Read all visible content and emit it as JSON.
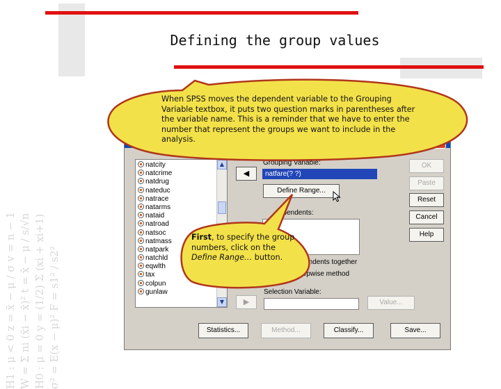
{
  "slide": {
    "title": "Defining the group values",
    "formula_lines": [
      "H1 : μ < 0     z = x̄ − μ / σ     v = n − 1",
      "W = Σ ni (x̄i − x̄)²     t = x̄ − μ / s/√n",
      "H0 : μ = 0     y = (1/2) Σ (xi + xi+1)",
      "σ² = E(x − μ)²     F = s1² / s2²"
    ]
  },
  "callouts": {
    "top": "When SPSS moves the dependent variable to the Grouping Variable textbox, it puts two question marks in parentheses after the variable name. This is a reminder that we have to enter the number that represent the groups we want to include in the analysis.",
    "bottom_bold": "First",
    "bottom_part1": ", to specify the group numbers, click on the ",
    "bottom_italic": "Define Range…",
    "bottom_part2": " button."
  },
  "dialog": {
    "close_glyph": "✕",
    "variables": [
      "natcity",
      "natcrime",
      "natdrug",
      "nateduc",
      "natrace",
      "natarms",
      "nataid",
      "natroad",
      "natsoc",
      "natmass",
      "natpark",
      "natchld",
      "eqwlth",
      "tax",
      "colpun",
      "gunlaw"
    ],
    "move_arrow": "◀",
    "move_arrow_disabled": "▶",
    "scroll_up": "▲",
    "scroll_down": "▼",
    "grouping_label": "Grouping Variable:",
    "grouping_value": "natfare(? ?)",
    "define_range_label": "Define Range...",
    "dependents_label": "ependents:",
    "together_label": "ependents together",
    "stepwise_label": "stepwise method",
    "selection_label": "Selection Variable:",
    "value_label": "Value...",
    "side_buttons": {
      "ok": "OK",
      "paste": "Paste",
      "reset": "Reset",
      "cancel": "Cancel",
      "help": "Help"
    },
    "bottom_buttons": {
      "statistics": "Statistics...",
      "method": "Method...",
      "classify": "Classify...",
      "save": "Save..."
    }
  },
  "colors": {
    "accent_red": "#e01010",
    "titlebar_blue": "#0a5bd6",
    "callout_fill": "#f3e14a",
    "callout_stroke": "#b0361a"
  }
}
